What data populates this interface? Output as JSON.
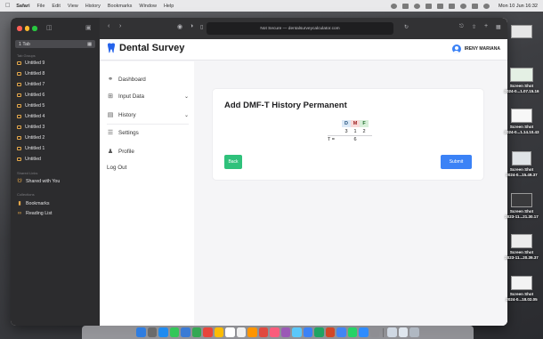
{
  "menubar": {
    "items": [
      "Safari",
      "File",
      "Edit",
      "View",
      "History",
      "Bookmarks",
      "Window",
      "Help"
    ],
    "clock": "Mon 10 Jun 16:32"
  },
  "safari": {
    "sidebar": {
      "tabgroup_label": "1 Tab",
      "section_tab_groups": "Tab Groups",
      "tab_groups": [
        "Untitled 9",
        "Untitled 8",
        "Untitled 7",
        "Untitled 6",
        "Untitled 5",
        "Untitled 4",
        "Untitled 3",
        "Untitled 2",
        "Untitled 1",
        "Untitled"
      ],
      "section_shared": "Shared Links",
      "shared_with_you": "Shared with You",
      "section_other": "Collections",
      "bookmarks": "Bookmarks",
      "reading_list": "Reading List"
    },
    "address": "Not Secure — dentalsurveycalculator.com"
  },
  "site": {
    "brand": "Dental Survey",
    "user_name": "IRENY MARIANA",
    "brand_color": "#2563eb",
    "nav": {
      "dashboard": "Dashboard",
      "input_data": "Input Data",
      "history": "History",
      "settings": "Settings",
      "profile": "Profile",
      "logout": "Log Out"
    }
  },
  "card": {
    "title": "Add DMF-T History Permanent",
    "dmf": {
      "headers": [
        "D",
        "M",
        "F"
      ],
      "values": [
        "3",
        "1",
        "2"
      ],
      "total_label": "T =",
      "total_value": "6"
    },
    "back_label": "Back",
    "submit_label": "Submit"
  },
  "desktop": {
    "screenshots": [
      {
        "title": "Screen Shot",
        "sub": "2024-0...1.07.15.16"
      },
      {
        "title": "Screen Shot",
        "sub": "2024-0...1.14.10.43"
      },
      {
        "title": "Screen Shot",
        "sub": "2024-0...15.49.37"
      },
      {
        "title": "Screen Shot",
        "sub": "2023-11...21.30.17"
      },
      {
        "title": "Screen Shot",
        "sub": "2023-11...20.39.37"
      },
      {
        "title": "Screen Shot",
        "sub": "2024-0...18.02.05"
      }
    ]
  }
}
